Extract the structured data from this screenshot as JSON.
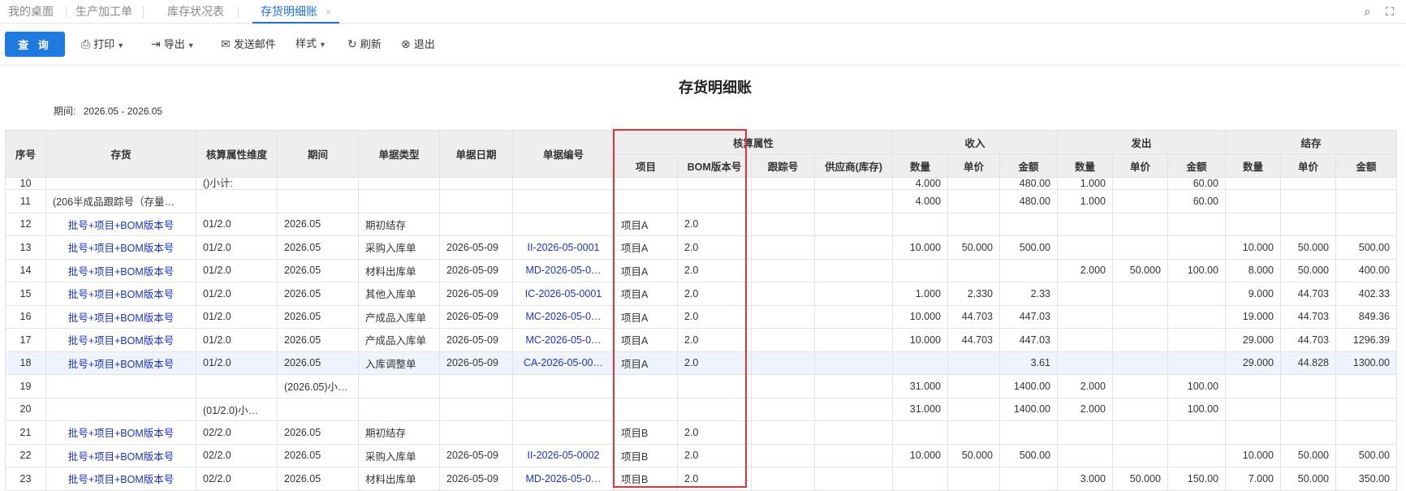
{
  "tabs": [
    {
      "label": "我的桌面"
    },
    {
      "label": "生产加工单"
    },
    {
      "label": "库存状况表"
    },
    {
      "label": "存货明细账"
    }
  ],
  "tab_close_glyph": "×",
  "toolbar": {
    "query": "查 询",
    "print": "打印",
    "export": "导出",
    "send_mail": "发送邮件",
    "style": "样式",
    "refresh": "刷新",
    "exit": "退出"
  },
  "report": {
    "title": "存货明细账",
    "period_label": "期间:",
    "period_value": "2026.05 - 2026.05"
  },
  "headers": {
    "seq": "序号",
    "inventory": "存货",
    "acct_dim": "核算属性维度",
    "period": "期间",
    "doc_type": "单据类型",
    "doc_date": "单据日期",
    "doc_no": "单据编号",
    "acct_attr": "核算属性",
    "income": "收入",
    "issue": "发出",
    "balance": "结存",
    "project": "项目",
    "bom": "BOM版本号",
    "tracking": "跟踪号",
    "supplier": "供应商(库存)",
    "qty": "数量",
    "price": "单价",
    "amount": "金额"
  },
  "rows": [
    {
      "seq": "10",
      "inv": "",
      "dim": "()小计:",
      "period": "",
      "type": "",
      "date": "",
      "no": "",
      "proj": "",
      "bom": "",
      "trk": "",
      "sup": "",
      "iq": "4.000",
      "ip": "",
      "ia": "480.00",
      "oq": "1.000",
      "op": "",
      "oa": "60.00",
      "bq": "",
      "bp": "",
      "ba": ""
    },
    {
      "seq": "11",
      "inv": "(206半成品跟踪号（存量…",
      "dim": "",
      "period": "",
      "type": "",
      "date": "",
      "no": "",
      "proj": "",
      "bom": "",
      "trk": "",
      "sup": "",
      "iq": "4.000",
      "ip": "",
      "ia": "480.00",
      "oq": "1.000",
      "op": "",
      "oa": "60.00",
      "bq": "",
      "bp": "",
      "ba": ""
    },
    {
      "seq": "12",
      "inv": "批号+项目+BOM版本号",
      "dim": "01/2.0",
      "period": "2026.05",
      "type": "期初结存",
      "date": "",
      "no": "",
      "proj": "项目A",
      "bom": "2.0",
      "trk": "",
      "sup": "",
      "iq": "",
      "ip": "",
      "ia": "",
      "oq": "",
      "op": "",
      "oa": "",
      "bq": "",
      "bp": "",
      "ba": ""
    },
    {
      "seq": "13",
      "inv": "批号+项目+BOM版本号",
      "dim": "01/2.0",
      "period": "2026.05",
      "type": "采购入库单",
      "date": "2026-05-09",
      "no": "II-2026-05-0001",
      "proj": "项目A",
      "bom": "2.0",
      "trk": "",
      "sup": "",
      "iq": "10.000",
      "ip": "50.000",
      "ia": "500.00",
      "oq": "",
      "op": "",
      "oa": "",
      "bq": "10.000",
      "bp": "50.000",
      "ba": "500.00"
    },
    {
      "seq": "14",
      "inv": "批号+项目+BOM版本号",
      "dim": "01/2.0",
      "period": "2026.05",
      "type": "材料出库单",
      "date": "2026-05-09",
      "no": "MD-2026-05-0…",
      "proj": "项目A",
      "bom": "2.0",
      "trk": "",
      "sup": "",
      "iq": "",
      "ip": "",
      "ia": "",
      "oq": "2.000",
      "op": "50.000",
      "oa": "100.00",
      "bq": "8.000",
      "bp": "50.000",
      "ba": "400.00"
    },
    {
      "seq": "15",
      "inv": "批号+项目+BOM版本号",
      "dim": "01/2.0",
      "period": "2026.05",
      "type": "其他入库单",
      "date": "2026-05-09",
      "no": "IC-2026-05-0001",
      "proj": "项目A",
      "bom": "2.0",
      "trk": "",
      "sup": "",
      "iq": "1.000",
      "ip": "2.330",
      "ia": "2.33",
      "oq": "",
      "op": "",
      "oa": "",
      "bq": "9.000",
      "bp": "44.703",
      "ba": "402.33"
    },
    {
      "seq": "16",
      "inv": "批号+项目+BOM版本号",
      "dim": "01/2.0",
      "period": "2026.05",
      "type": "产成品入库单",
      "date": "2026-05-09",
      "no": "MC-2026-05-0…",
      "proj": "项目A",
      "bom": "2.0",
      "trk": "",
      "sup": "",
      "iq": "10.000",
      "ip": "44.703",
      "ia": "447.03",
      "oq": "",
      "op": "",
      "oa": "",
      "bq": "19.000",
      "bp": "44.703",
      "ba": "849.36"
    },
    {
      "seq": "17",
      "inv": "批号+项目+BOM版本号",
      "dim": "01/2.0",
      "period": "2026.05",
      "type": "产成品入库单",
      "date": "2026-05-09",
      "no": "MC-2026-05-0…",
      "proj": "项目A",
      "bom": "2.0",
      "trk": "",
      "sup": "",
      "iq": "10.000",
      "ip": "44.703",
      "ia": "447.03",
      "oq": "",
      "op": "",
      "oa": "",
      "bq": "29.000",
      "bp": "44.703",
      "ba": "1296.39"
    },
    {
      "seq": "18",
      "inv": "批号+项目+BOM版本号",
      "dim": "01/2.0",
      "period": "2026.05",
      "type": "入库调整单",
      "date": "2026-05-09",
      "no": "CA-2026-05-00…",
      "proj": "项目A",
      "bom": "2.0",
      "trk": "",
      "sup": "",
      "iq": "",
      "ip": "",
      "ia": "3.61",
      "oq": "",
      "op": "",
      "oa": "",
      "bq": "29.000",
      "bp": "44.828",
      "ba": "1300.00"
    },
    {
      "seq": "19",
      "inv": "",
      "dim": "",
      "period": "(2026.05)小…",
      "type": "",
      "date": "",
      "no": "",
      "proj": "",
      "bom": "",
      "trk": "",
      "sup": "",
      "iq": "31.000",
      "ip": "",
      "ia": "1400.00",
      "oq": "2.000",
      "op": "",
      "oa": "100.00",
      "bq": "",
      "bp": "",
      "ba": ""
    },
    {
      "seq": "20",
      "inv": "",
      "dim": "(01/2.0)小…",
      "period": "",
      "type": "",
      "date": "",
      "no": "",
      "proj": "",
      "bom": "",
      "trk": "",
      "sup": "",
      "iq": "31.000",
      "ip": "",
      "ia": "1400.00",
      "oq": "2.000",
      "op": "",
      "oa": "100.00",
      "bq": "",
      "bp": "",
      "ba": ""
    },
    {
      "seq": "21",
      "inv": "批号+项目+BOM版本号",
      "dim": "02/2.0",
      "period": "2026.05",
      "type": "期初结存",
      "date": "",
      "no": "",
      "proj": "项目B",
      "bom": "2.0",
      "trk": "",
      "sup": "",
      "iq": "",
      "ip": "",
      "ia": "",
      "oq": "",
      "op": "",
      "oa": "",
      "bq": "",
      "bp": "",
      "ba": ""
    },
    {
      "seq": "22",
      "inv": "批号+项目+BOM版本号",
      "dim": "02/2.0",
      "period": "2026.05",
      "type": "采购入库单",
      "date": "2026-05-09",
      "no": "II-2026-05-0002",
      "proj": "项目B",
      "bom": "2.0",
      "trk": "",
      "sup": "",
      "iq": "10.000",
      "ip": "50.000",
      "ia": "500.00",
      "oq": "",
      "op": "",
      "oa": "",
      "bq": "10.000",
      "bp": "50.000",
      "ba": "500.00"
    },
    {
      "seq": "23",
      "inv": "批号+项目+BOM版本号",
      "dim": "02/2.0",
      "period": "2026.05",
      "type": "材料出库单",
      "date": "2026-05-09",
      "no": "MD-2026-05-0…",
      "proj": "项目B",
      "bom": "2.0",
      "trk": "",
      "sup": "",
      "iq": "",
      "ip": "",
      "ia": "",
      "oq": "3.000",
      "op": "50.000",
      "oa": "150.00",
      "bq": "7.000",
      "bp": "50.000",
      "ba": "350.00"
    }
  ],
  "highlight_seq": "18",
  "colors": {
    "accent": "#1f6feb",
    "query_button": "#1f7ae0",
    "link": "#1a33cc",
    "highlight_box": "#e0333a"
  }
}
